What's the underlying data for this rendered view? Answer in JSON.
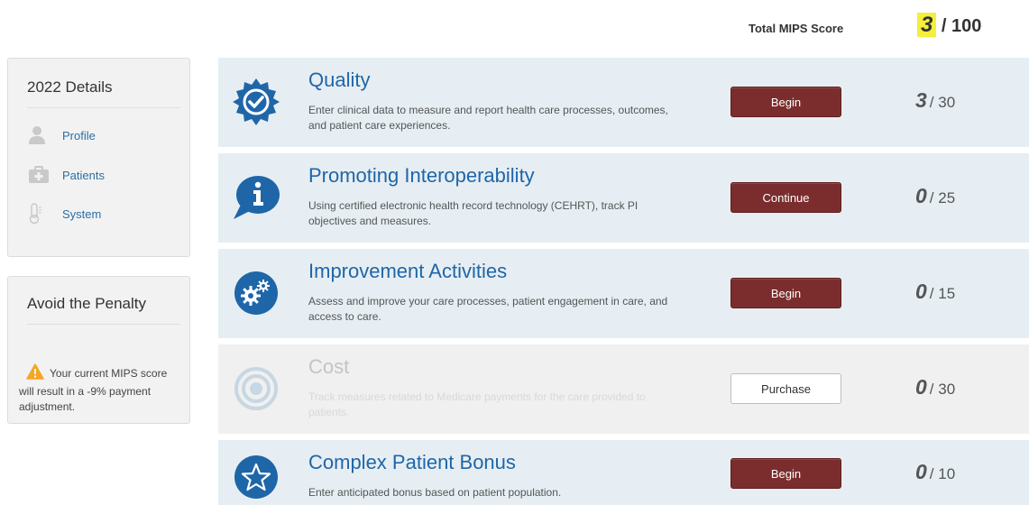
{
  "header": {
    "total_label": "Total MIPS Score",
    "total_score": "3",
    "total_max": "/ 100"
  },
  "sidebar": {
    "details_title": "2022 Details",
    "items": [
      {
        "label": "Profile",
        "icon": "person-icon"
      },
      {
        "label": "Patients",
        "icon": "medical-kit-icon"
      },
      {
        "label": "System",
        "icon": "thermometer-icon"
      }
    ],
    "penalty_title": "Avoid the Penalty",
    "penalty_text": "Your current MIPS score will result in a -9% payment adjustment.",
    "warning_color": "#f5a623"
  },
  "categories": [
    {
      "title": "Quality",
      "description": "Enter clinical data to measure and report health care processes, outcomes, and patient care experiences.",
      "button": "Begin",
      "score": "3",
      "max": "/ 30",
      "icon": "badge-check-icon"
    },
    {
      "title": "Promoting Interoperability",
      "description": "Using certified electronic health record technology (CEHRT), track PI objectives and measures.",
      "button": "Continue",
      "score": "0",
      "max": "/ 25",
      "icon": "info-bubble-icon"
    },
    {
      "title": "Improvement Activities",
      "description": "Assess and improve your care processes, patient engagement in care, and access to care.",
      "button": "Begin",
      "score": "0",
      "max": "/ 15",
      "icon": "gears-icon"
    },
    {
      "title": "Cost",
      "description": "Track measures related to Medicare payments for the care provided to patients.",
      "button": "Purchase",
      "score": "0",
      "max": "/ 30",
      "icon": "target-icon"
    },
    {
      "title": "Complex Patient Bonus",
      "description": "Enter anticipated bonus based on patient population.",
      "button": "Begin",
      "score": "0",
      "max": "/ 10",
      "icon": "star-icon"
    }
  ],
  "colors": {
    "brand_blue": "#1f66a8",
    "button_maroon": "#7b2d2d",
    "card_bg": "#e6eef3",
    "highlight": "#f5ee3b"
  }
}
